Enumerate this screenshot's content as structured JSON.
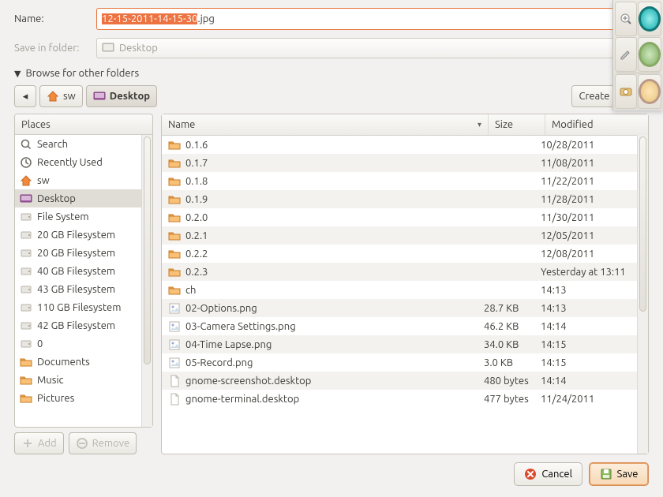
{
  "labels": {
    "name": "Name:",
    "save_in": "Save in folder:",
    "browse": "Browse for other folders",
    "create_folder": "Create Folder",
    "add": "Add",
    "remove": "Remove",
    "cancel": "Cancel",
    "save": "Save"
  },
  "filename": {
    "selected": "12-15-2011-14-15-30",
    "suffix": ".jpg"
  },
  "save_folder": "Desktop",
  "breadcrumb": [
    {
      "label": "sw",
      "icon": "home"
    },
    {
      "label": "Desktop",
      "icon": "desktop",
      "active": true
    }
  ],
  "places_header": "Places",
  "places": [
    {
      "label": "Search",
      "icon": "search"
    },
    {
      "label": "Recently Used",
      "icon": "recent"
    },
    {
      "label": "sw",
      "icon": "home"
    },
    {
      "label": "Desktop",
      "icon": "desktop",
      "selected": true
    },
    {
      "label": "File System",
      "icon": "drive"
    },
    {
      "label": "20 GB Filesystem",
      "icon": "drive"
    },
    {
      "label": "20 GB Filesystem",
      "icon": "drive"
    },
    {
      "label": "40 GB Filesystem",
      "icon": "drive"
    },
    {
      "label": "43 GB Filesystem",
      "icon": "drive"
    },
    {
      "label": "110 GB Filesystem",
      "icon": "drive"
    },
    {
      "label": "42 GB Filesystem",
      "icon": "drive"
    },
    {
      "label": "0",
      "icon": "drive"
    },
    {
      "label": "Documents",
      "icon": "folder"
    },
    {
      "label": "Music",
      "icon": "folder"
    },
    {
      "label": "Pictures",
      "icon": "folder"
    }
  ],
  "columns": {
    "name": "Name",
    "size": "Size",
    "modified": "Modified"
  },
  "files": [
    {
      "name": "0.1.6",
      "icon": "folder",
      "size": "",
      "modified": "10/28/2011"
    },
    {
      "name": "0.1.7",
      "icon": "folder",
      "size": "",
      "modified": "11/08/2011"
    },
    {
      "name": "0.1.8",
      "icon": "folder",
      "size": "",
      "modified": "11/22/2011"
    },
    {
      "name": "0.1.9",
      "icon": "folder",
      "size": "",
      "modified": "11/28/2011"
    },
    {
      "name": "0.2.0",
      "icon": "folder",
      "size": "",
      "modified": "11/30/2011"
    },
    {
      "name": "0.2.1",
      "icon": "folder",
      "size": "",
      "modified": "12/05/2011"
    },
    {
      "name": "0.2.2",
      "icon": "folder",
      "size": "",
      "modified": "12/08/2011"
    },
    {
      "name": "0.2.3",
      "icon": "folder",
      "size": "",
      "modified": "Yesterday at 13:11"
    },
    {
      "name": "ch",
      "icon": "folder",
      "size": "",
      "modified": "14:13"
    },
    {
      "name": "02-Options.png",
      "icon": "image",
      "size": "28.7 KB",
      "modified": "14:13"
    },
    {
      "name": "03-Camera Settings.png",
      "icon": "image",
      "size": "46.2 KB",
      "modified": "14:14"
    },
    {
      "name": "04-Time Lapse.png",
      "icon": "image",
      "size": "34.0 KB",
      "modified": "14:15"
    },
    {
      "name": "05-Record.png",
      "icon": "image",
      "size": "3.0 KB",
      "modified": "14:15"
    },
    {
      "name": "gnome-screenshot.desktop",
      "icon": "file",
      "size": "480 bytes",
      "modified": "14:14"
    },
    {
      "name": "gnome-terminal.desktop",
      "icon": "file",
      "size": "477 bytes",
      "modified": "11/24/2011"
    }
  ]
}
